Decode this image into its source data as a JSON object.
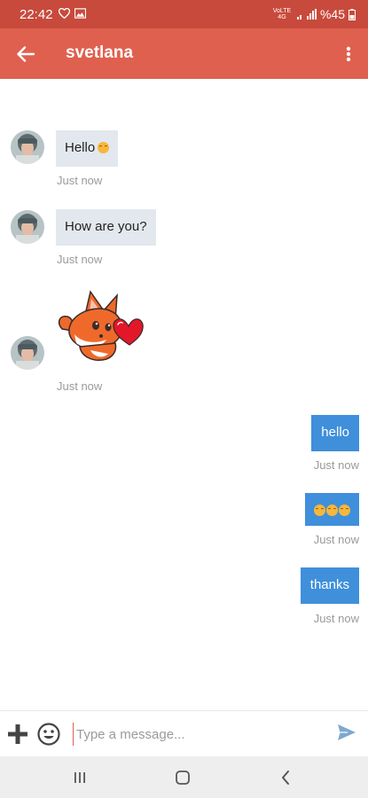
{
  "status_bar": {
    "time": "22:42",
    "network_label": "VoLTE 4G",
    "battery": "%45"
  },
  "header": {
    "title": "svetlana"
  },
  "messages_in": [
    {
      "text": "Hello",
      "time": "Just now"
    },
    {
      "text": "How are you?",
      "time": "Just now"
    },
    {
      "sticker": "fox-heart-sticker",
      "time": "Just now"
    }
  ],
  "messages_out": [
    {
      "text": "hello",
      "time": "Just now"
    },
    {
      "emoji_count": 3,
      "time": "Just now"
    },
    {
      "text": "thanks",
      "time": "Just now"
    }
  ],
  "composer": {
    "placeholder": "Type a message..."
  },
  "colors": {
    "status_bar": "#c84a3c",
    "app_bar": "#e0604f",
    "incoming_bubble": "#e3e8ee",
    "outgoing_bubble": "#3f8fdb",
    "send_icon": "#7fa8cf"
  }
}
